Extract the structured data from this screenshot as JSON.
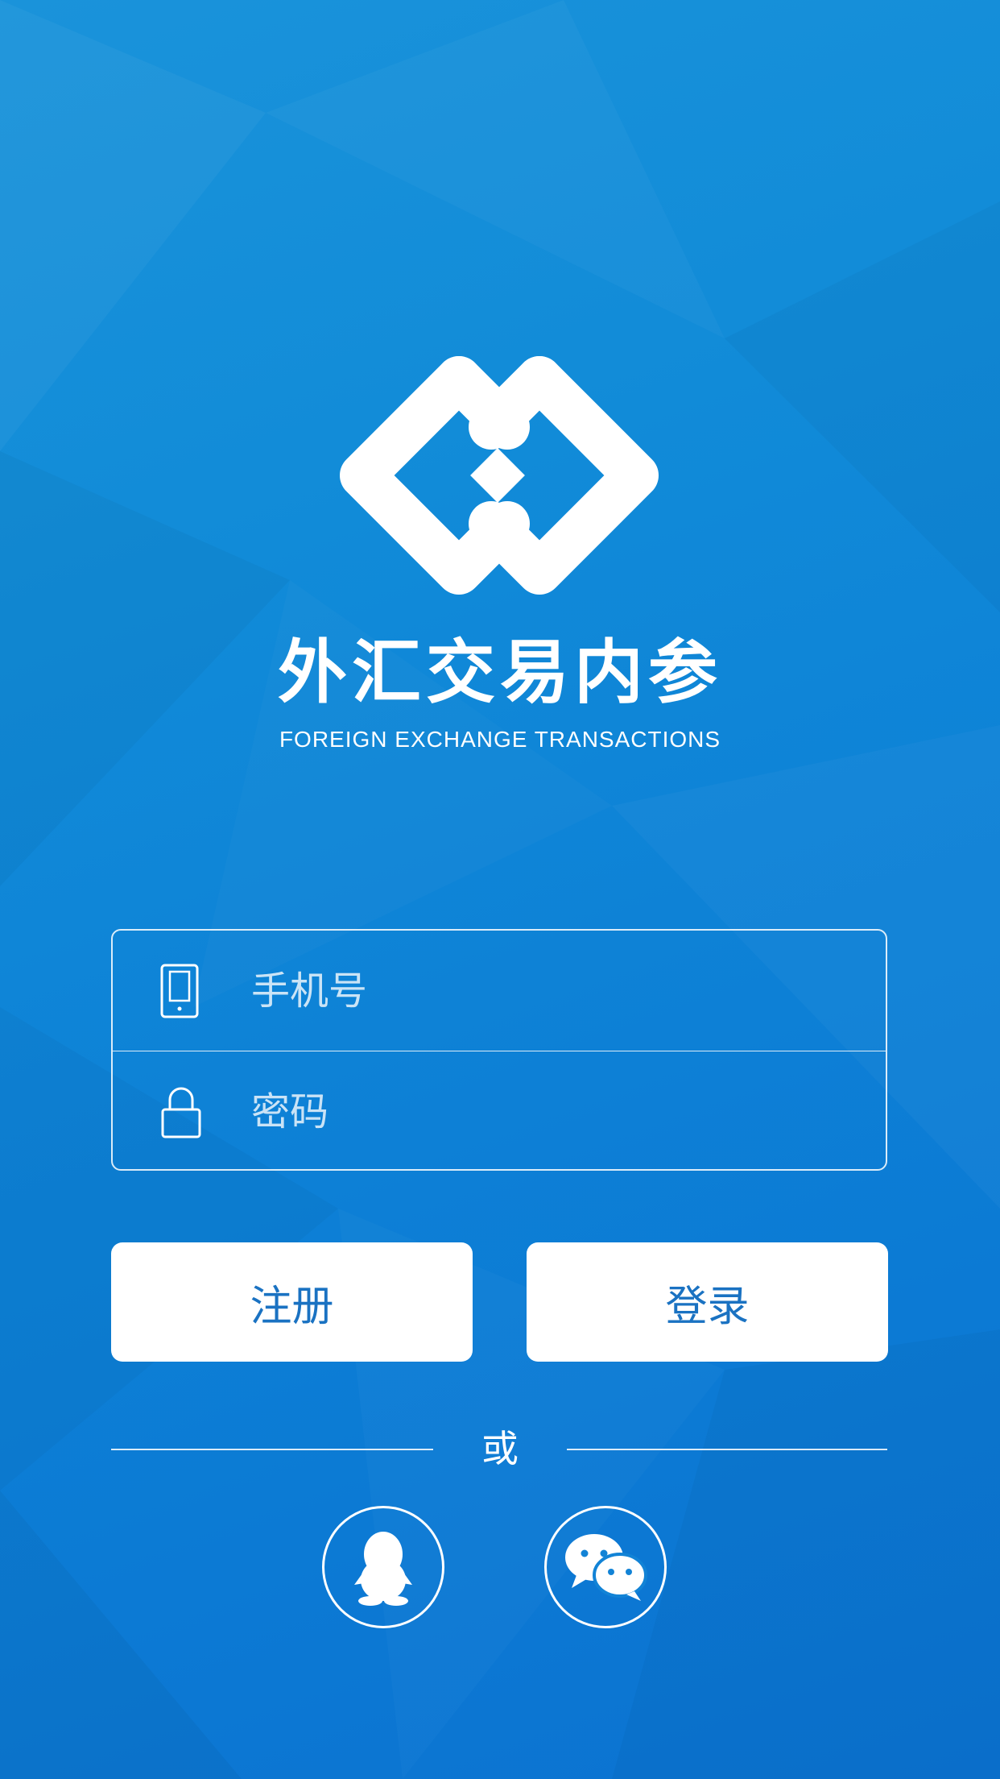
{
  "app": {
    "title": "外汇交易内参",
    "subtitle": "FOREIGN EXCHANGE TRANSACTIONS",
    "logo_icon": "exchange-logo-icon"
  },
  "form": {
    "phone": {
      "placeholder": "手机号",
      "value": "",
      "icon": "phone-icon"
    },
    "password": {
      "placeholder": "密码",
      "value": "",
      "icon": "lock-icon"
    }
  },
  "buttons": {
    "register_label": "注册",
    "login_label": "登录"
  },
  "divider": {
    "text": "或"
  },
  "social": [
    {
      "name": "qq",
      "icon": "qq-penguin-icon"
    },
    {
      "name": "wechat",
      "icon": "wechat-icon"
    }
  ],
  "colors": {
    "background_top": "#1a93da",
    "background_bottom": "#0b72d1",
    "button_text": "#1a72c2",
    "foreground": "#ffffff"
  }
}
